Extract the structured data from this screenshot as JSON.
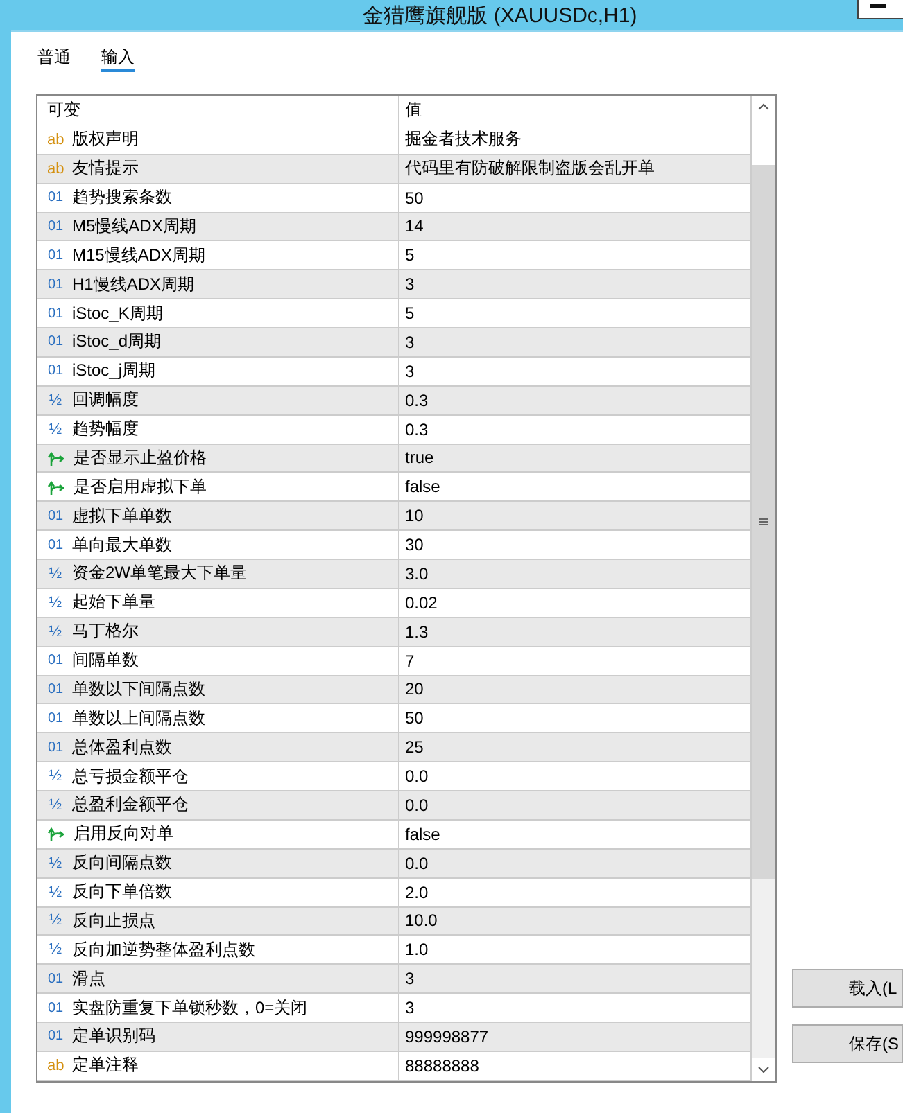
{
  "window": {
    "title": "金猎鹰旗舰版 (XAUUSDc,H1)"
  },
  "tabs": [
    {
      "label": "普通",
      "selected": false
    },
    {
      "label": "输入",
      "selected": true
    }
  ],
  "table": {
    "columns": [
      "可变",
      "值"
    ],
    "rows": [
      {
        "kind": "string",
        "icon": "ab",
        "name": "版权声明",
        "value": "掘金者技术服务"
      },
      {
        "kind": "string",
        "icon": "ab",
        "name": "友情提示",
        "value": "代码里有防破解限制盗版会乱开单"
      },
      {
        "kind": "int",
        "icon": "01",
        "name": "趋势搜索条数",
        "value": "50"
      },
      {
        "kind": "int",
        "icon": "01",
        "name": "M5慢线ADX周期",
        "value": "14"
      },
      {
        "kind": "int",
        "icon": "01",
        "name": "M15慢线ADX周期",
        "value": "5"
      },
      {
        "kind": "int",
        "icon": "01",
        "name": "H1慢线ADX周期",
        "value": "3"
      },
      {
        "kind": "int",
        "icon": "01",
        "name": "iStoc_K周期",
        "value": "5"
      },
      {
        "kind": "int",
        "icon": "01",
        "name": "iStoc_d周期",
        "value": "3"
      },
      {
        "kind": "int",
        "icon": "01",
        "name": "iStoc_j周期",
        "value": "3"
      },
      {
        "kind": "double",
        "icon": "½",
        "name": "回调幅度",
        "value": "0.3"
      },
      {
        "kind": "double",
        "icon": "½",
        "name": "趋势幅度",
        "value": "0.3"
      },
      {
        "kind": "bool",
        "name": "是否显示止盈价格",
        "value": "true"
      },
      {
        "kind": "bool",
        "name": "是否启用虚拟下单",
        "value": "false"
      },
      {
        "kind": "int",
        "icon": "01",
        "name": "虚拟下单单数",
        "value": "10"
      },
      {
        "kind": "int",
        "icon": "01",
        "name": "单向最大单数",
        "value": "30"
      },
      {
        "kind": "double",
        "icon": "½",
        "name": "资金2W单笔最大下单量",
        "value": "3.0"
      },
      {
        "kind": "double",
        "icon": "½",
        "name": "起始下单量",
        "value": "0.02"
      },
      {
        "kind": "double",
        "icon": "½",
        "name": "马丁格尔",
        "value": "1.3"
      },
      {
        "kind": "int",
        "icon": "01",
        "name": "间隔单数",
        "value": "7"
      },
      {
        "kind": "int",
        "icon": "01",
        "name": "单数以下间隔点数",
        "value": "20"
      },
      {
        "kind": "int",
        "icon": "01",
        "name": "单数以上间隔点数",
        "value": "50"
      },
      {
        "kind": "int",
        "icon": "01",
        "name": "总体盈利点数",
        "value": "25"
      },
      {
        "kind": "double",
        "icon": "½",
        "name": "总亏损金额平仓",
        "value": "0.0"
      },
      {
        "kind": "double",
        "icon": "½",
        "name": "总盈利金额平仓",
        "value": "0.0"
      },
      {
        "kind": "bool",
        "name": "启用反向对单",
        "value": "false"
      },
      {
        "kind": "double",
        "icon": "½",
        "name": "反向间隔点数",
        "value": "0.0"
      },
      {
        "kind": "double",
        "icon": "½",
        "name": "反向下单倍数",
        "value": "2.0"
      },
      {
        "kind": "double",
        "icon": "½",
        "name": "反向止损点",
        "value": "10.0"
      },
      {
        "kind": "double",
        "icon": "½",
        "name": "反向加逆势整体盈利点数",
        "value": "1.0"
      },
      {
        "kind": "int",
        "icon": "01",
        "name": "滑点",
        "value": "3"
      },
      {
        "kind": "int",
        "icon": "01",
        "name": "实盘防重复下单锁秒数，0=关闭",
        "value": "3"
      },
      {
        "kind": "int",
        "icon": "01",
        "name": "定单识别码",
        "value": "999998877"
      },
      {
        "kind": "string",
        "icon": "ab",
        "name": "定单注释",
        "value": "88888888"
      }
    ]
  },
  "buttons": [
    {
      "label": "载入(L"
    },
    {
      "label": "保存(S"
    }
  ]
}
